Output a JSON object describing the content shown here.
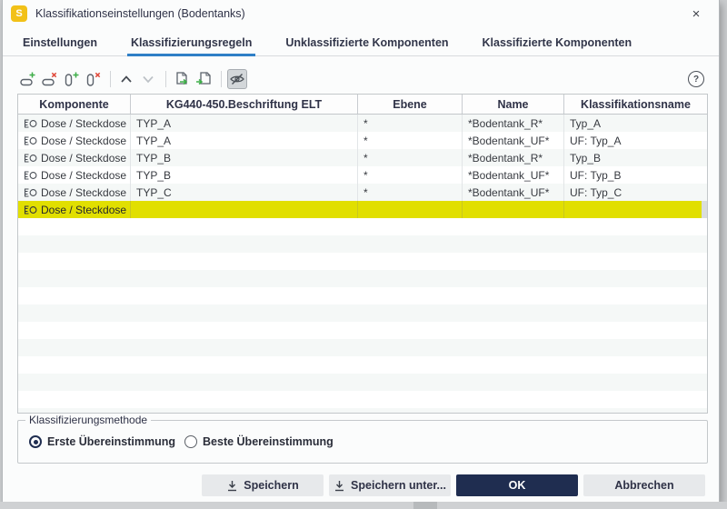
{
  "window": {
    "title": "Klassifikationseinstellungen (Bodentanks)",
    "icon_letter": "S",
    "close_glyph": "×"
  },
  "tabs": [
    {
      "label": "Einstellungen",
      "active": false
    },
    {
      "label": "Klassifizierungsregeln",
      "active": true
    },
    {
      "label": "Unklassifizierte Komponenten",
      "active": false
    },
    {
      "label": "Klassifizierte Komponenten",
      "active": false
    }
  ],
  "toolbar": {
    "icons": [
      "add-row",
      "delete-row",
      "add-column",
      "delete-column",
      "move-up",
      "move-down",
      "import-rules",
      "export-rules",
      "toggle-hidden-eye-slash",
      "help"
    ],
    "help_glyph": "?"
  },
  "table": {
    "columns": [
      "Komponente",
      "KG440-450.Beschriftung ELT",
      "Ebene",
      "Name",
      "Klassifikationsname"
    ],
    "rows": [
      {
        "komponente": "Dose / Steckdose",
        "beschriftung": "TYP_A",
        "ebene": "*",
        "name": "*Bodentank_R*",
        "klassifikationsname": "Typ_A"
      },
      {
        "komponente": "Dose / Steckdose",
        "beschriftung": "TYP_A",
        "ebene": "*",
        "name": "*Bodentank_UF*",
        "klassifikationsname": "UF: Typ_A"
      },
      {
        "komponente": "Dose / Steckdose",
        "beschriftung": "TYP_B",
        "ebene": "*",
        "name": "*Bodentank_R*",
        "klassifikationsname": "Typ_B"
      },
      {
        "komponente": "Dose / Steckdose",
        "beschriftung": "TYP_B",
        "ebene": "*",
        "name": "*Bodentank_UF*",
        "klassifikationsname": "UF: Typ_B"
      },
      {
        "komponente": "Dose / Steckdose",
        "beschriftung": "TYP_C",
        "ebene": "*",
        "name": "*Bodentank_UF*",
        "klassifikationsname": "UF: Typ_C"
      },
      {
        "komponente": "Dose / Steckdose",
        "beschriftung": "",
        "ebene": "",
        "name": "",
        "klassifikationsname": "",
        "selected": true
      }
    ]
  },
  "method": {
    "legend": "Klassifizierungsmethode",
    "options": [
      {
        "label": "Erste Übereinstimmung",
        "selected": true
      },
      {
        "label": "Beste Übereinstimmung",
        "selected": false
      }
    ]
  },
  "buttons": {
    "save": "Speichern",
    "save_as": "Speichern unter...",
    "ok": "OK",
    "cancel": "Abbrechen"
  },
  "colors": {
    "accent_blue": "#2f7fc7",
    "highlight_yellow": "#e1df00",
    "primary_dark": "#1f2d50",
    "app_icon_yellow": "#f2c118",
    "icon_green": "#3fae49",
    "icon_red": "#e04b3c"
  }
}
